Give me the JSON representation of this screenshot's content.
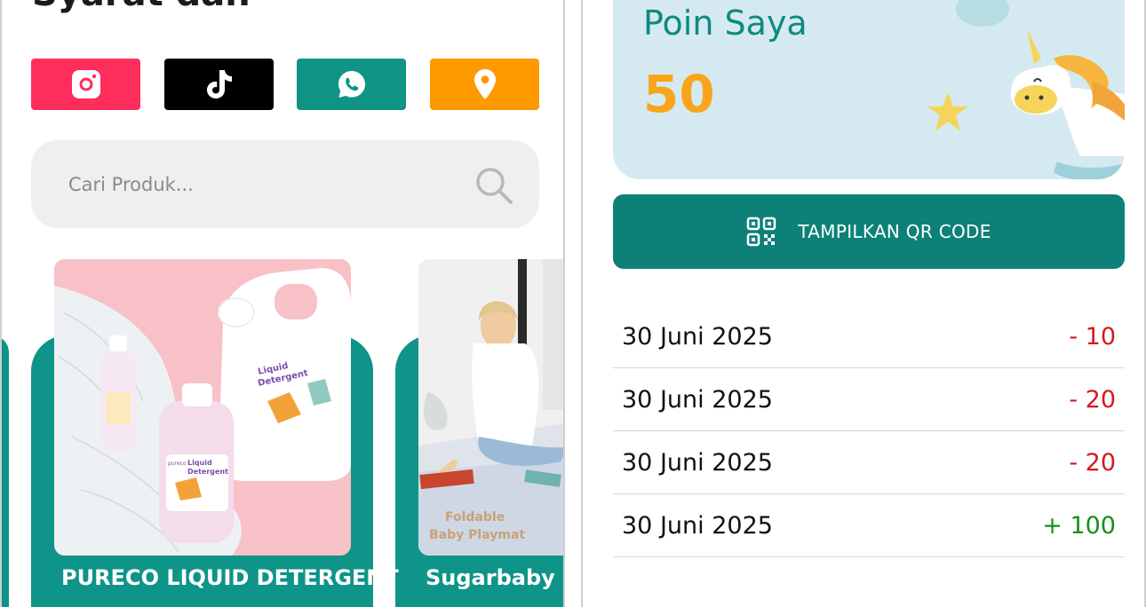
{
  "left": {
    "heading": "Syarat dan",
    "social_buttons": [
      {
        "name": "instagram",
        "icon": "instagram-icon",
        "color": "#ff2d5c"
      },
      {
        "name": "tiktok",
        "icon": "tiktok-icon",
        "color": "#000000"
      },
      {
        "name": "whatsapp",
        "icon": "whatsapp-icon",
        "color": "#0f9486"
      },
      {
        "name": "location",
        "icon": "location-pin-icon",
        "color": "#ff9900"
      }
    ],
    "search": {
      "placeholder": "Cari Produk..."
    },
    "products": [
      {
        "title": "PURECO LIQUID DETERGENT",
        "image_labels": [
          "Liquid Detergent",
          "pureco"
        ]
      },
      {
        "title": "Sugarbaby Fo Playmat",
        "image_labels": [
          "Foldable Baby Playmat"
        ]
      }
    ]
  },
  "right": {
    "points_label": "Poin Saya",
    "points_value": "50",
    "qr_button_label": "TAMPILKAN QR CODE",
    "history": [
      {
        "date": "30 Juni 2025",
        "amount": "- 10",
        "type": "debit"
      },
      {
        "date": "30 Juni 2025",
        "amount": "- 20",
        "type": "debit"
      },
      {
        "date": "30 Juni 2025",
        "amount": "- 20",
        "type": "debit"
      },
      {
        "date": "30 Juni 2025",
        "amount": "+ 100",
        "type": "credit"
      }
    ]
  },
  "colors": {
    "teal": "#0e9488",
    "teal_dark": "#0d8178",
    "orange_points": "#f8a51c",
    "negative": "#d3191e",
    "positive": "#14901d"
  }
}
